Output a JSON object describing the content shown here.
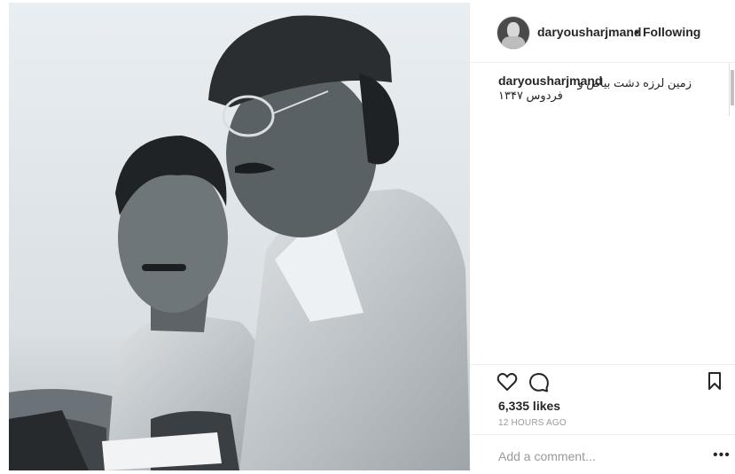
{
  "post": {
    "photo_alt": "",
    "header": {
      "username": "daryousharjmand",
      "separator": "•",
      "follow_status": "Following"
    },
    "caption": {
      "username": "daryousharjmand",
      "text_line1": "زمین لرزه دشت بیاض و",
      "text_line2": "فردوس ۱۳۴۷"
    },
    "actions": {
      "like_icon": "heart-icon",
      "comment_icon": "comment-bubble-icon",
      "save_icon": "bookmark-icon"
    },
    "likes": "6,335 likes",
    "timestamp": "12 HOURS AGO",
    "comment_input": {
      "placeholder": "Add a comment..."
    },
    "more_options": "•••"
  }
}
